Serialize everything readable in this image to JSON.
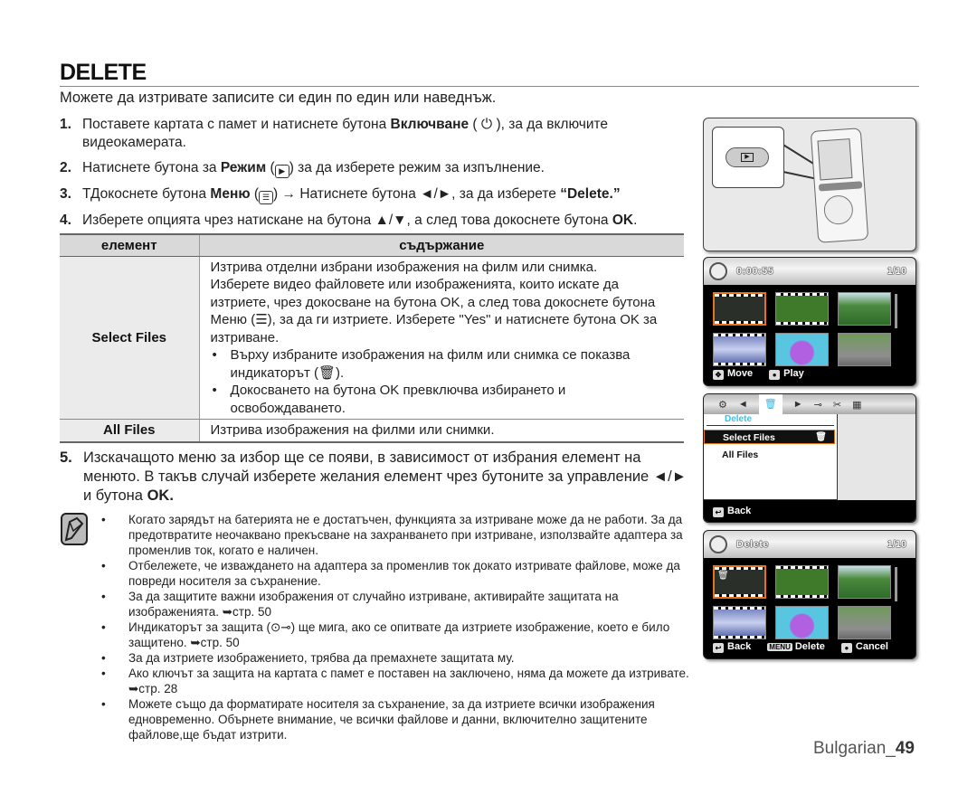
{
  "page": {
    "title": "DELETE",
    "intro": "Можете да изтривате записите си един по един или наведнъж.",
    "footer_lang": "Bulgarian_",
    "footer_page": "49"
  },
  "steps": [
    {
      "num": "1.",
      "pre": "Поставете картата с памет и натиснете бутона ",
      "bold": "Включване",
      "icon": "power-icon",
      "icon_glyph": "⏻",
      "post": ", за да включите видеокамерата."
    },
    {
      "num": "2.",
      "pre": "Натиснете бутона за ",
      "bold": "Режим",
      "icon": "play-mode-icon",
      "icon_glyph": "▶",
      "post": " за да изберете режим за изпълнение."
    },
    {
      "num": "3.",
      "pre": "ТДокоснете бутона ",
      "bold": "Меню",
      "icon": "menu-icon",
      "icon_glyph": "☰",
      "post": " → Натиснете бутона ◄/►, за да изберете ",
      "bold2": "“Delete.”"
    },
    {
      "num": "4.",
      "pre": "Изберете опцията чрез натискане на бутона ▲/▼, а след това докоснете бутона ",
      "bold": "OK",
      "post": "."
    }
  ],
  "table": {
    "headers": [
      "елемент",
      "съдържание"
    ],
    "rows": [
      {
        "item": "Select Files",
        "lines": [
          "Изтрива отделни избрани изображения на филм или снимка.",
          "Изберете видео файловете или изображенията, които искате да изтриете, чрез докосване на бутона OK, а след това докоснете бутона Меню (☰), за да ги изтриете. Изберете \"Yes\" и натиснете бутона OK за изтриване."
        ],
        "bullets": [
          "Върху избраните изображения на филм или снимка се показва индикаторът (🗑).",
          "Докосването на бутона OK превключва избирането и освобождаването."
        ]
      },
      {
        "item": "All Files",
        "lines": [
          "Изтрива изображения на филми или снимки."
        ]
      }
    ]
  },
  "step5": {
    "num": "5.",
    "text": "Изскачащото меню за избор ще се появи, в зависимост от избрания елемент на менюто. В такъв случай изберете желания елемент чрез бутоните за управление ◄/► и бутона ",
    "bold": "OK."
  },
  "notes": [
    "Когато зарядът на батерията не е достатъчен, функцията за изтриване може да не работи. За да предотвратите неочаквано прекъсване на захранването при изтриване, използвайте адаптера за променлив ток, когато е наличен.",
    "Отбележете, че изваждането на адаптера за променлив ток докато изтривате файлове, може да повреди носителя за съхранение.",
    "За да защитите важни изображения от случайно изтриване, активирайте защитата на изображенията. ➥стр. 50",
    "Индикаторът за защита (⊙⊸) ще мига, ако се опитвате да изтриете изображение, което е било защитено. ➥стр. 50",
    "За да изтриете изображението, трябва да премахнете защитата му.",
    "Ако ключът за защита на картата с памет е поставен на заключено, няма да можете да изтривате. ➥стр. 28",
    "Можете също да форматирате носителя за съхранение, за да изтриете всички изображения едновременно. Обърнете внимание, че всички файлове и данни, включително защитените файлове,ще бъдат изтрити."
  ],
  "screens": {
    "thumbnail_view": {
      "time": "0:00:55",
      "counter": "1/10",
      "foot": [
        "Move",
        "Play"
      ]
    },
    "menu_view": {
      "tabs": [
        "⚙",
        "◄",
        "🗑",
        "►",
        "⊸",
        "✂",
        "▦"
      ],
      "title": "Delete",
      "items": [
        "Select Files",
        "All Files"
      ],
      "selected": "Select Files",
      "foot": "Back"
    },
    "delete_view": {
      "label": "Delete",
      "counter": "1/10",
      "foot_back": "Back",
      "foot_menu_key": "MENU",
      "foot_delete": "Delete",
      "foot_cancel": "Cancel"
    }
  },
  "colors": {
    "accent_selection": "#e8711c",
    "menu_highlight": "#33c4ee"
  }
}
